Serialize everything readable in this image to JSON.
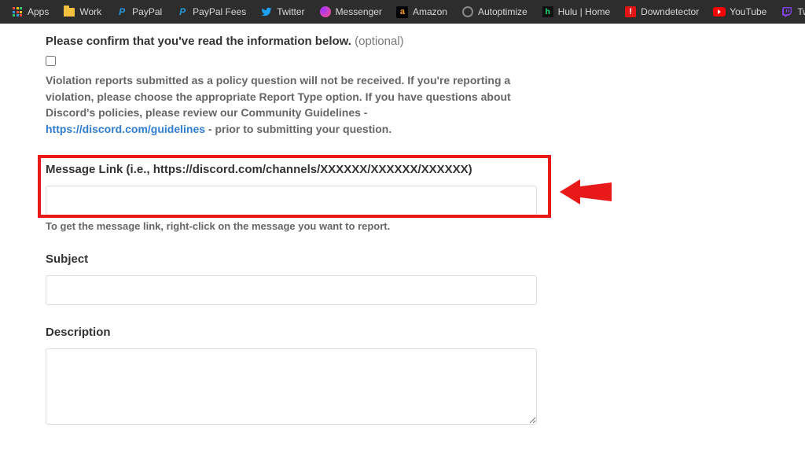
{
  "bookmarks": {
    "apps": "Apps",
    "work": "Work",
    "paypal": "PayPal",
    "paypal_fees": "PayPal Fees",
    "twitter": "Twitter",
    "messenger": "Messenger",
    "amazon": "Amazon",
    "autoptimize": "Autoptimize",
    "hulu": "Hulu | Home",
    "downdetector": "Downdetector",
    "youtube": "YouTube",
    "twitch": "Twitch"
  },
  "form": {
    "confirm_heading": "Please confirm that you've read the information below.",
    "optional": "(optional)",
    "disclaimer_p1": "Violation reports submitted as a policy question will not be received. If you're reporting a violation, please choose the appropriate Report Type option. If you have questions about Discord's policies, please review our Community Guidelines - ",
    "disclaimer_link": "https://discord.com/guidelines",
    "disclaimer_p2": " - prior to submitting your question.",
    "message_link_label": "Message Link (i.e., https://discord.com/channels/XXXXXX/XXXXXX/XXXXXX)",
    "message_link_hint": "To get the message link, right-click on the message you want to report.",
    "subject_label": "Subject",
    "description_label": "Description"
  }
}
